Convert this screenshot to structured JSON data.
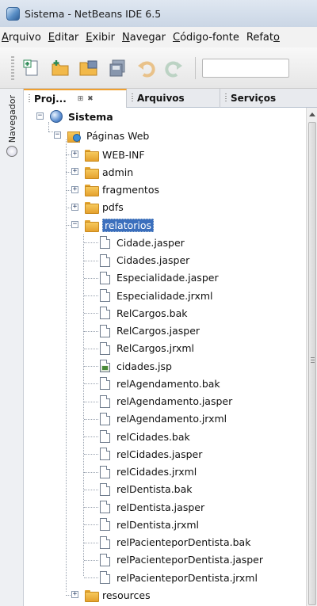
{
  "window": {
    "title": "Sistema - NetBeans IDE 6.5"
  },
  "menubar": {
    "items": [
      {
        "pre": "",
        "u": "A",
        "post": "rquivo"
      },
      {
        "pre": "",
        "u": "E",
        "post": "ditar"
      },
      {
        "pre": "",
        "u": "E",
        "post": "xibir"
      },
      {
        "pre": "",
        "u": "N",
        "post": "avegar"
      },
      {
        "pre": "",
        "u": "C",
        "post": "ódigo-fonte"
      },
      {
        "pre": "Refat",
        "u": "o",
        "post": ""
      }
    ]
  },
  "toolbar": {
    "buttons": [
      "new-file-icon",
      "new-project-icon",
      "open-project-icon",
      "save-all-icon",
      "undo-icon",
      "redo-icon"
    ]
  },
  "side": {
    "navigator_label": "Navegador"
  },
  "tabs": {
    "projects": "Proj...",
    "controls": "⊞ ✖",
    "files": "Arquivos",
    "services": "Serviços"
  },
  "tree": {
    "root": "Sistema",
    "web_pages": "Páginas Web",
    "folders_top": [
      "WEB-INF",
      "admin",
      "fragmentos",
      "pdfs"
    ],
    "selected_folder": "relatorios",
    "files": [
      "Cidade.jasper",
      "Cidades.jasper",
      "Especialidade.jasper",
      "Especialidade.jrxml",
      "RelCargos.bak",
      "RelCargos.jasper",
      "RelCargos.jrxml",
      "cidades.jsp",
      "relAgendamento.bak",
      "relAgendamento.jasper",
      "relAgendamento.jrxml",
      "relCidades.bak",
      "relCidades.jasper",
      "relCidades.jrxml",
      "relDentista.bak",
      "relDentista.jasper",
      "relDentista.jrxml",
      "relPacienteporDentista.bak",
      "relPacienteporDentista.jasper",
      "relPacienteporDentista.jrxml"
    ],
    "folder_bottom": "resources"
  },
  "colors": {
    "selection": "#3b6fbd",
    "folder": "#e5a12e"
  }
}
